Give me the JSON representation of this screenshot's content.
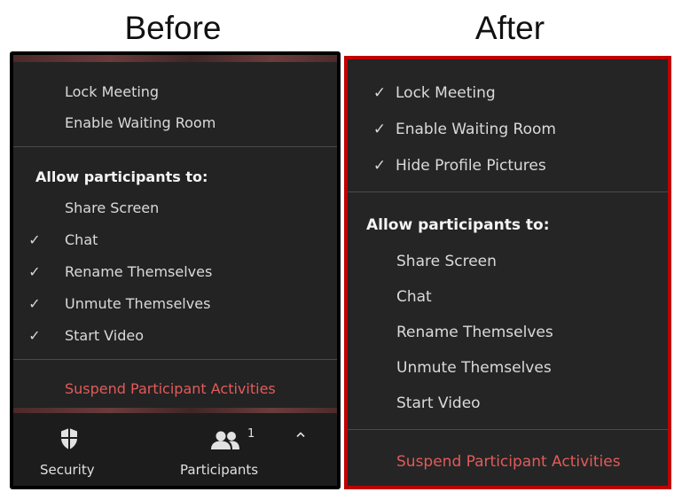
{
  "headings": {
    "before": "Before",
    "after": "After"
  },
  "before_panel": {
    "security_items": [
      {
        "label": "Lock Meeting",
        "checked": false
      },
      {
        "label": "Enable Waiting Room",
        "checked": false
      }
    ],
    "allow_header": "Allow participants to:",
    "allow_items": [
      {
        "label": "Share Screen",
        "checked": false
      },
      {
        "label": "Chat",
        "checked": true
      },
      {
        "label": "Rename Themselves",
        "checked": true
      },
      {
        "label": "Unmute Themselves",
        "checked": true
      },
      {
        "label": "Start Video",
        "checked": true
      }
    ],
    "suspend_label": "Suspend Participant Activities",
    "toolbar": {
      "security_label": "Security",
      "security_icon": "shield-icon",
      "participants_label": "Participants",
      "participants_icon": "participants-icon",
      "participants_count": "1",
      "expand_icon": "chevron-up-icon"
    }
  },
  "after_panel": {
    "security_items": [
      {
        "label": "Lock Meeting",
        "checked": true
      },
      {
        "label": "Enable Waiting Room",
        "checked": true
      },
      {
        "label": "Hide Profile Pictures",
        "checked": true
      }
    ],
    "allow_header": "Allow participants to:",
    "allow_items": [
      {
        "label": "Share Screen",
        "checked": false
      },
      {
        "label": "Chat",
        "checked": false
      },
      {
        "label": "Rename Themselves",
        "checked": false
      },
      {
        "label": "Unmute Themselves",
        "checked": false
      },
      {
        "label": "Start Video",
        "checked": false
      }
    ],
    "suspend_label": "Suspend Participant Activities"
  },
  "check_glyph": "✓",
  "colors": {
    "before_border": "#000000",
    "after_border": "#c00000",
    "menu_bg": "#232323",
    "danger_text": "#e35a5a"
  }
}
